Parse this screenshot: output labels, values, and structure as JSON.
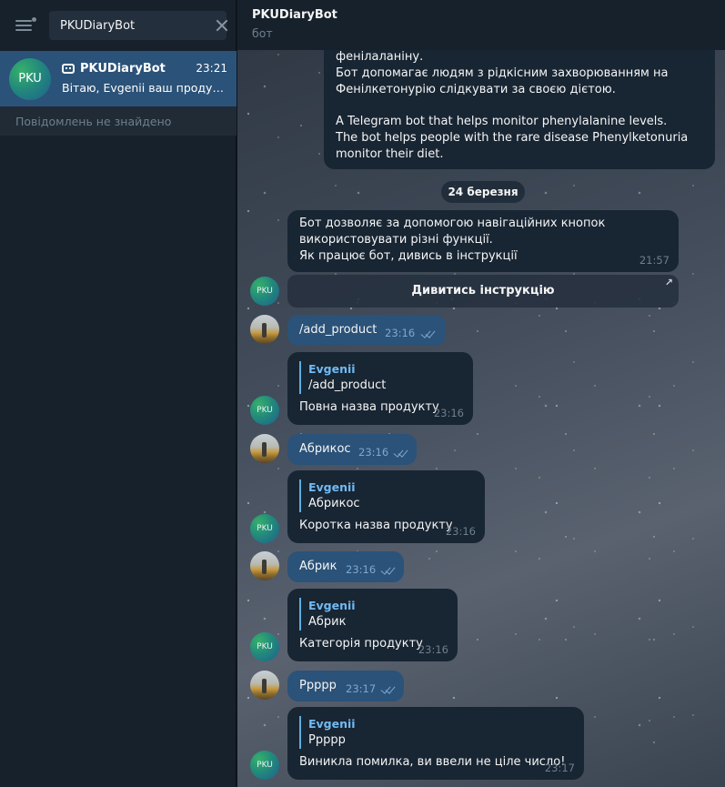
{
  "sidebar": {
    "search_value": "PKUDiaryBot",
    "chat": {
      "avatar_text": "PKU",
      "name": "PKUDiaryBot",
      "time": "23:21",
      "preview": "Вітаю, Evgenii ваш продукт ..."
    },
    "no_messages": "Повідомлень не знайдено"
  },
  "header": {
    "title": "PKUDiaryBot",
    "subtitle": "бот"
  },
  "messages": {
    "intro": {
      "lines": [
        "фенілаланіну.",
        "Бот допомагає людям з рідкісним захворюванням на",
        "Фенілкетонурію слідкувати за своєю дієтою.",
        "",
        "A Telegram bot that helps monitor phenylalanine levels.",
        "The bot helps people with the rare disease Phenylketonuria",
        "monitor their diet."
      ]
    },
    "date": "24 березня",
    "nav": {
      "lines": [
        "Бот дозволяє за допомогою навігаційних кнопок",
        "використовувати різні функції.",
        "Як працює бот, дивись в інструкції"
      ],
      "time": "21:57",
      "button": "Дивитись інструкцію",
      "button_arrow": "↗"
    },
    "out1": {
      "text": "/add_product",
      "time": "23:16"
    },
    "in1": {
      "reply_name": "Evgenii",
      "reply_text": "/add_product",
      "text": "Повна назва продукту",
      "time": "23:16"
    },
    "out2": {
      "text": "Абрикос",
      "time": "23:16"
    },
    "in2": {
      "reply_name": "Evgenii",
      "reply_text": "Абрикос",
      "text": "Коротка назва продукту",
      "time": "23:16"
    },
    "out3": {
      "text": "Абрик",
      "time": "23:16"
    },
    "in3": {
      "reply_name": "Evgenii",
      "reply_text": "Абрик",
      "text": "Категорія продукту",
      "time": "23:16"
    },
    "out4": {
      "text": "Ррррр",
      "time": "23:17"
    },
    "in4": {
      "reply_name": "Evgenii",
      "reply_text": "Ррррр",
      "text": "Виникла помилка, ви ввели не ціле число!",
      "time": "23:17"
    }
  },
  "avatars": {
    "bot_text": "PKU"
  },
  "colors": {
    "sidebar_bg": "#17212b",
    "active_chat": "#2b5278",
    "incoming_bubble": "#182533",
    "outgoing_bubble": "#2b5278",
    "link_blue": "#71baf2"
  }
}
